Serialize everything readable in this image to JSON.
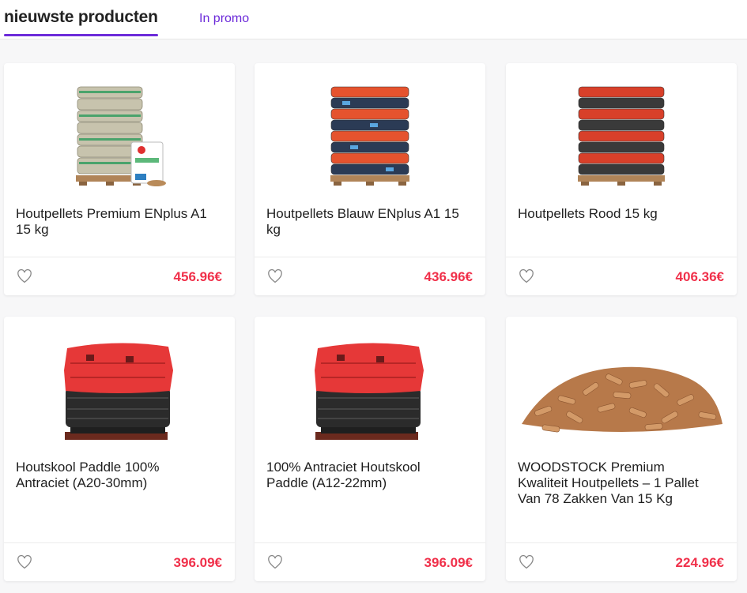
{
  "tabs": {
    "active_label": "nieuwste producten",
    "promo_label": "In promo"
  },
  "colors": {
    "accent": "#6c2bd9",
    "price": "#f0304a"
  },
  "products": [
    {
      "title": "Houtpellets Premium ENplus A1 15 kg",
      "price": "456.96€",
      "image": "green-bag-pallet"
    },
    {
      "title": "Houtpellets Blauw ENplus A1 15 kg",
      "price": "436.96€",
      "image": "blue-red-bag-pallet"
    },
    {
      "title": "Houtpellets Rood 15 kg",
      "price": "406.36€",
      "image": "red-bag-pallet"
    },
    {
      "title": "Houtskool Paddle 100% Antraciet (A20-30mm)",
      "price": "396.09€",
      "image": "charcoal-pallet"
    },
    {
      "title": "100% Antraciet Houtskool Paddle (A12-22mm)",
      "price": "396.09€",
      "image": "charcoal-pallet"
    },
    {
      "title": "WOODSTOCK Premium Kwaliteit Houtpellets – 1 Pallet Van 78 Zakken Van 15 Kg",
      "price": "224.96€",
      "image": "wood-pellets-pile"
    }
  ]
}
